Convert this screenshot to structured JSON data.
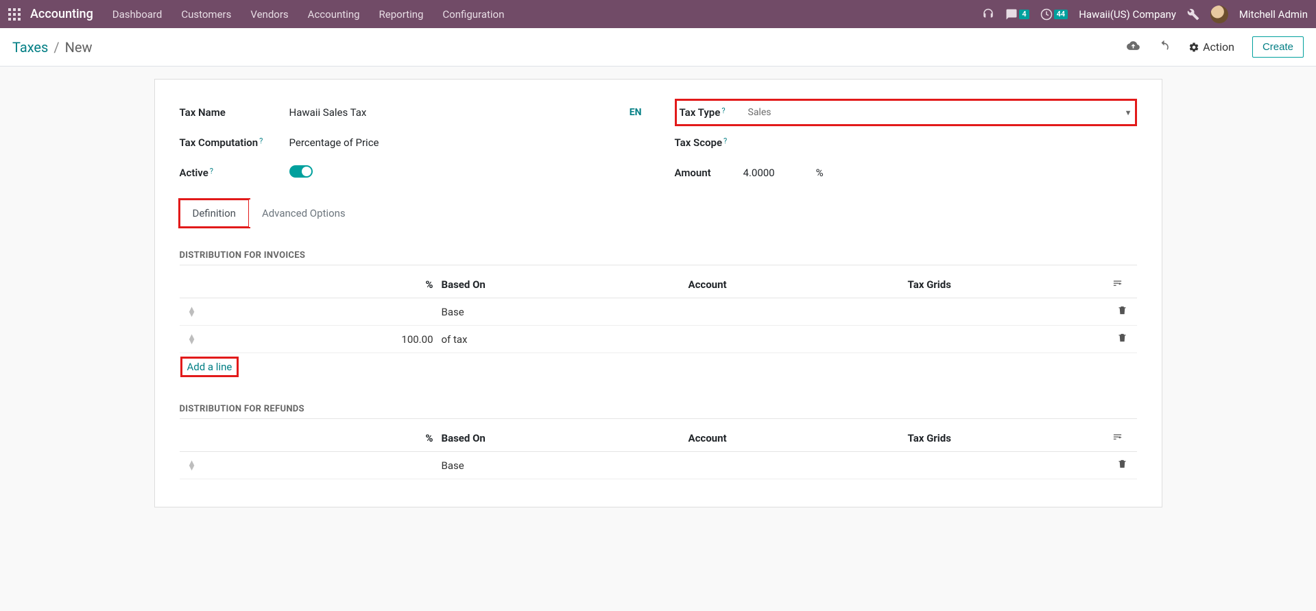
{
  "navbar": {
    "brand": "Accounting",
    "links": [
      "Dashboard",
      "Customers",
      "Vendors",
      "Accounting",
      "Reporting",
      "Configuration"
    ],
    "chat_badge": "4",
    "activity_badge": "44",
    "company": "Hawaii(US) Company",
    "user": "Mitchell Admin"
  },
  "breadcrumb": {
    "root": "Taxes",
    "current": "New"
  },
  "controlbar": {
    "action_label": "Action",
    "create_label": "Create"
  },
  "form": {
    "tax_name_label": "Tax Name",
    "tax_name_value": "Hawaii Sales Tax",
    "lang_badge": "EN",
    "tax_computation_label": "Tax Computation",
    "tax_computation_value": "Percentage of Price",
    "active_label": "Active",
    "tax_type_label": "Tax Type",
    "tax_type_value": "Sales",
    "tax_scope_label": "Tax Scope",
    "amount_label": "Amount",
    "amount_value": "4.0000",
    "amount_unit": "%"
  },
  "tabs": {
    "definition": "Definition",
    "advanced": "Advanced Options"
  },
  "dist_invoices": {
    "title": "Distribution for Invoices",
    "cols": {
      "pct": "%",
      "based_on": "Based On",
      "account": "Account",
      "tax_grids": "Tax Grids"
    },
    "rows": [
      {
        "pct": "",
        "based_on": "Base"
      },
      {
        "pct": "100.00",
        "based_on": "of tax"
      }
    ],
    "add_line": "Add a line"
  },
  "dist_refunds": {
    "title": "Distribution for Refunds",
    "cols": {
      "pct": "%",
      "based_on": "Based On",
      "account": "Account",
      "tax_grids": "Tax Grids"
    },
    "rows": [
      {
        "pct": "",
        "based_on": "Base"
      }
    ]
  }
}
